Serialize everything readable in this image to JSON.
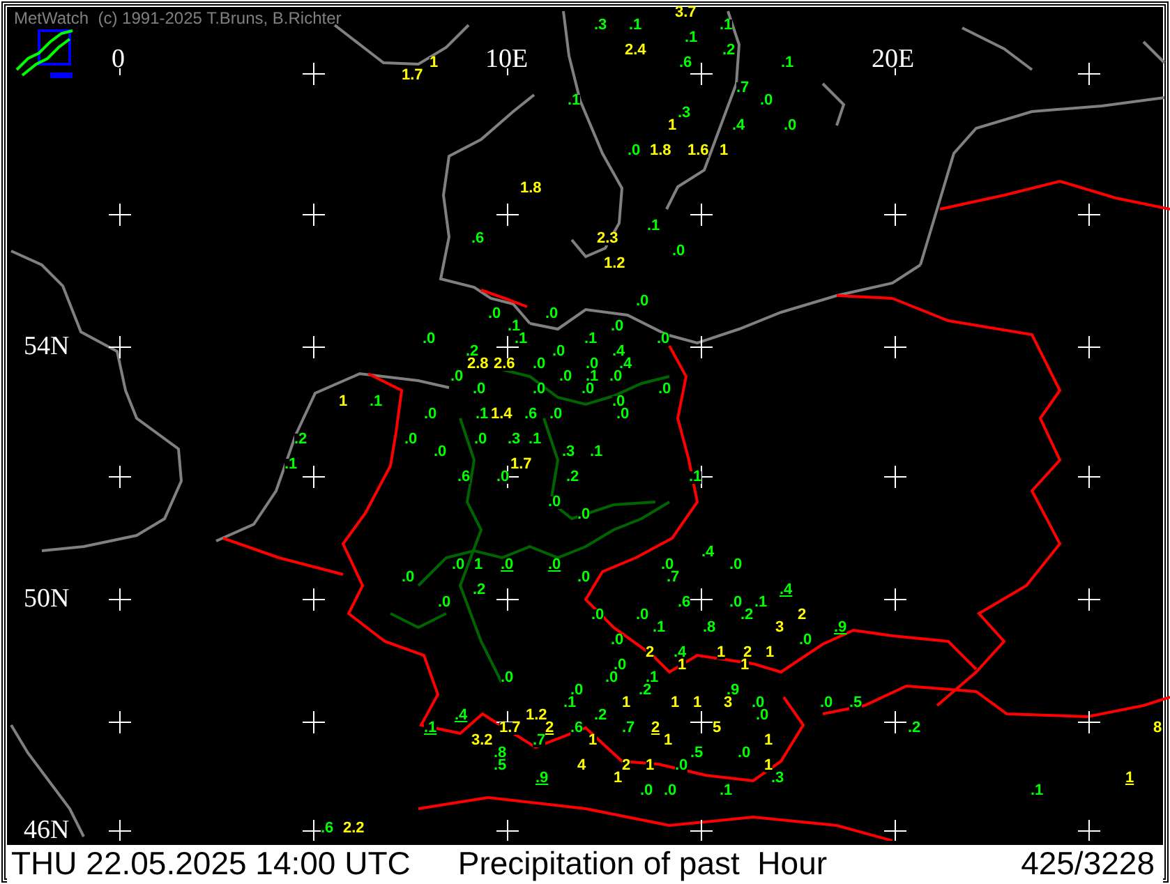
{
  "header": {
    "credit": "MetWatch  (c) 1991-2025 T.Bruns, B.Richter"
  },
  "grid_labels": [
    {
      "text": "0"
    },
    {
      "text": "10E"
    },
    {
      "text": "20E"
    },
    {
      "text": "54N"
    },
    {
      "text": "50N"
    },
    {
      "text": "46N"
    }
  ],
  "readings": [
    {
      "value": "3.7",
      "color": "#ffff00",
      "underlined": false
    },
    {
      "value": ".3",
      "color": "#00ff00",
      "underlined": false
    },
    {
      "value": ".1",
      "color": "#00ff00",
      "underlined": false
    },
    {
      "value": ".1",
      "color": "#00ff00",
      "underlined": false
    },
    {
      "value": ".1",
      "color": "#00ff00",
      "underlined": false
    },
    {
      "value": "2.4",
      "color": "#ffff00",
      "underlined": false
    },
    {
      "value": ".2",
      "color": "#00ff00",
      "underlined": false
    },
    {
      "value": "1",
      "color": "#ffff00",
      "underlined": false
    },
    {
      "value": ".6",
      "color": "#00ff00",
      "underlined": false
    },
    {
      "value": ".1",
      "color": "#00ff00",
      "underlined": false
    },
    {
      "value": "1.7",
      "color": "#ffff00",
      "underlined": false
    },
    {
      "value": ".7",
      "color": "#00ff00",
      "underlined": false
    },
    {
      "value": ".1",
      "color": "#00ff00",
      "underlined": false
    },
    {
      "value": ".0",
      "color": "#00ff00",
      "underlined": false
    },
    {
      "value": ".3",
      "color": "#00ff00",
      "underlined": false
    },
    {
      "value": "1",
      "color": "#ffff00",
      "underlined": false
    },
    {
      "value": ".4",
      "color": "#00ff00",
      "underlined": false
    },
    {
      "value": ".0",
      "color": "#00ff00",
      "underlined": false
    },
    {
      "value": ".0",
      "color": "#00ff00",
      "underlined": false
    },
    {
      "value": "1.8",
      "color": "#ffff00",
      "underlined": false
    },
    {
      "value": "1.6",
      "color": "#ffff00",
      "underlined": false
    },
    {
      "value": "1",
      "color": "#ffff00",
      "underlined": false
    },
    {
      "value": "1.8",
      "color": "#ffff00",
      "underlined": false
    },
    {
      "value": ".1",
      "color": "#00ff00",
      "underlined": false
    },
    {
      "value": ".6",
      "color": "#00ff00",
      "underlined": false
    },
    {
      "value": "2.3",
      "color": "#ffff00",
      "underlined": false
    },
    {
      "value": ".0",
      "color": "#00ff00",
      "underlined": false
    },
    {
      "value": "1.2",
      "color": "#ffff00",
      "underlined": false
    },
    {
      "value": ".0",
      "color": "#00ff00",
      "underlined": false
    },
    {
      "value": ".0",
      "color": "#00ff00",
      "underlined": false
    },
    {
      "value": ".0",
      "color": "#00ff00",
      "underlined": false
    },
    {
      "value": ".1",
      "color": "#00ff00",
      "underlined": false
    },
    {
      "value": ".0",
      "color": "#00ff00",
      "underlined": false
    },
    {
      "value": ".0",
      "color": "#00ff00",
      "underlined": false
    },
    {
      "value": ".1",
      "color": "#00ff00",
      "underlined": false
    },
    {
      "value": ".1",
      "color": "#00ff00",
      "underlined": false
    },
    {
      "value": ".0",
      "color": "#00ff00",
      "underlined": false
    },
    {
      "value": ".2",
      "color": "#00ff00",
      "underlined": false
    },
    {
      "value": ".0",
      "color": "#00ff00",
      "underlined": false
    },
    {
      "value": ".4",
      "color": "#00ff00",
      "underlined": false
    },
    {
      "value": "2.8",
      "color": "#ffff00",
      "underlined": false
    },
    {
      "value": "2.6",
      "color": "#ffff00",
      "underlined": false
    },
    {
      "value": ".0",
      "color": "#00ff00",
      "underlined": false
    },
    {
      "value": ".0",
      "color": "#00ff00",
      "underlined": false
    },
    {
      "value": ".4",
      "color": "#00ff00",
      "underlined": false
    },
    {
      "value": ".0",
      "color": "#00ff00",
      "underlined": false
    },
    {
      "value": ".0",
      "color": "#00ff00",
      "underlined": false
    },
    {
      "value": ".1",
      "color": "#00ff00",
      "underlined": false
    },
    {
      "value": ".0",
      "color": "#00ff00",
      "underlined": false
    },
    {
      "value": ".0",
      "color": "#00ff00",
      "underlined": false
    },
    {
      "value": ".0",
      "color": "#00ff00",
      "underlined": false
    },
    {
      "value": ".0",
      "color": "#00ff00",
      "underlined": false
    },
    {
      "value": ".0",
      "color": "#00ff00",
      "underlined": false
    },
    {
      "value": "1",
      "color": "#ffff00",
      "underlined": false
    },
    {
      "value": ".1",
      "color": "#00ff00",
      "underlined": false
    },
    {
      "value": ".0",
      "color": "#00ff00",
      "underlined": false
    },
    {
      "value": ".0",
      "color": "#00ff00",
      "underlined": false
    },
    {
      "value": ".1",
      "color": "#00ff00",
      "underlined": false
    },
    {
      "value": "1.4",
      "color": "#ffff00",
      "underlined": false
    },
    {
      "value": ".6",
      "color": "#00ff00",
      "underlined": false
    },
    {
      "value": ".0",
      "color": "#00ff00",
      "underlined": false
    },
    {
      "value": ".0",
      "color": "#00ff00",
      "underlined": false
    },
    {
      "value": ".2",
      "color": "#00ff00",
      "underlined": false
    },
    {
      "value": ".0",
      "color": "#00ff00",
      "underlined": false
    },
    {
      "value": ".0",
      "color": "#00ff00",
      "underlined": false
    },
    {
      "value": ".3",
      "color": "#00ff00",
      "underlined": false
    },
    {
      "value": ".1",
      "color": "#00ff00",
      "underlined": false
    },
    {
      "value": ".0",
      "color": "#00ff00",
      "underlined": false
    },
    {
      "value": ".3",
      "color": "#00ff00",
      "underlined": false
    },
    {
      "value": ".1",
      "color": "#00ff00",
      "underlined": false
    },
    {
      "value": ".1",
      "color": "#00ff00",
      "underlined": false
    },
    {
      "value": "1.7",
      "color": "#ffff00",
      "underlined": false
    },
    {
      "value": ".6",
      "color": "#00ff00",
      "underlined": false
    },
    {
      "value": ".0",
      "color": "#00ff00",
      "underlined": false
    },
    {
      "value": ".2",
      "color": "#00ff00",
      "underlined": false
    },
    {
      "value": ".1",
      "color": "#00ff00",
      "underlined": false
    },
    {
      "value": ".0",
      "color": "#00ff00",
      "underlined": false
    },
    {
      "value": ".0",
      "color": "#00ff00",
      "underlined": false
    },
    {
      "value": ".4",
      "color": "#00ff00",
      "underlined": false
    },
    {
      "value": ".0",
      "color": "#00ff00",
      "underlined": false
    },
    {
      "value": "1",
      "color": "#00ff00",
      "underlined": false
    },
    {
      "value": ".0",
      "color": "#00ff00",
      "underlined": true
    },
    {
      "value": ".0",
      "color": "#00ff00",
      "underlined": true
    },
    {
      "value": ".0",
      "color": "#00ff00",
      "underlined": false
    },
    {
      "value": ".0",
      "color": "#00ff00",
      "underlined": false
    },
    {
      "value": ".0",
      "color": "#00ff00",
      "underlined": false
    },
    {
      "value": ".0",
      "color": "#00ff00",
      "underlined": false
    },
    {
      "value": ".7",
      "color": "#00ff00",
      "underlined": false
    },
    {
      "value": ".2",
      "color": "#00ff00",
      "underlined": false
    },
    {
      "value": ".4",
      "color": "#00ff00",
      "underlined": true
    },
    {
      "value": ".0",
      "color": "#00ff00",
      "underlined": false
    },
    {
      "value": ".6",
      "color": "#00ff00",
      "underlined": false
    },
    {
      "value": ".0",
      "color": "#00ff00",
      "underlined": false
    },
    {
      "value": ".1",
      "color": "#00ff00",
      "underlined": false
    },
    {
      "value": ".0",
      "color": "#00ff00",
      "underlined": false
    },
    {
      "value": ".0",
      "color": "#00ff00",
      "underlined": false
    },
    {
      "value": ".2",
      "color": "#00ff00",
      "underlined": false
    },
    {
      "value": "2",
      "color": "#ffff00",
      "underlined": false
    },
    {
      "value": ".1",
      "color": "#00ff00",
      "underlined": false
    },
    {
      "value": ".8",
      "color": "#00ff00",
      "underlined": false
    },
    {
      "value": "3",
      "color": "#ffff00",
      "underlined": false
    },
    {
      "value": ".9",
      "color": "#00ff00",
      "underlined": true
    },
    {
      "value": ".0",
      "color": "#00ff00",
      "underlined": false
    },
    {
      "value": ".0",
      "color": "#00ff00",
      "underlined": false
    },
    {
      "value": "2",
      "color": "#ffff00",
      "underlined": false
    },
    {
      "value": ".4",
      "color": "#00ff00",
      "underlined": false
    },
    {
      "value": "1",
      "color": "#ffff00",
      "underlined": false
    },
    {
      "value": "2",
      "color": "#ffff00",
      "underlined": false
    },
    {
      "value": "1",
      "color": "#ffff00",
      "underlined": false
    },
    {
      "value": ".0",
      "color": "#00ff00",
      "underlined": false
    },
    {
      "value": "1",
      "color": "#ffff00",
      "underlined": false
    },
    {
      "value": "1",
      "color": "#ffff00",
      "underlined": false
    },
    {
      "value": ".0",
      "color": "#00ff00",
      "underlined": false
    },
    {
      "value": ".0",
      "color": "#00ff00",
      "underlined": false
    },
    {
      "value": ".1",
      "color": "#00ff00",
      "underlined": false
    },
    {
      "value": ".0",
      "color": "#00ff00",
      "underlined": false
    },
    {
      "value": ".2",
      "color": "#00ff00",
      "underlined": false
    },
    {
      "value": ".9",
      "color": "#00ff00",
      "underlined": false
    },
    {
      "value": ".1",
      "color": "#00ff00",
      "underlined": false
    },
    {
      "value": "1",
      "color": "#ffff00",
      "underlined": false
    },
    {
      "value": "1",
      "color": "#ffff00",
      "underlined": false
    },
    {
      "value": "1",
      "color": "#ffff00",
      "underlined": false
    },
    {
      "value": "3",
      "color": "#ffff00",
      "underlined": false
    },
    {
      "value": ".0",
      "color": "#00ff00",
      "underlined": false
    },
    {
      "value": ".0",
      "color": "#00ff00",
      "underlined": false
    },
    {
      "value": ".5",
      "color": "#00ff00",
      "underlined": false
    },
    {
      "value": ".4",
      "color": "#00ff00",
      "underlined": true
    },
    {
      "value": "1.2",
      "color": "#ffff00",
      "underlined": false
    },
    {
      "value": ".2",
      "color": "#00ff00",
      "underlined": false
    },
    {
      "value": ".0",
      "color": "#00ff00",
      "underlined": false
    },
    {
      "value": ".1",
      "color": "#00ff00",
      "underlined": true
    },
    {
      "value": "1.7",
      "color": "#ffff00",
      "underlined": false
    },
    {
      "value": "2",
      "color": "#ffff00",
      "underlined": true
    },
    {
      "value": ".6",
      "color": "#00ff00",
      "underlined": false
    },
    {
      "value": ".7",
      "color": "#00ff00",
      "underlined": false
    },
    {
      "value": "2",
      "color": "#ffff00",
      "underlined": true
    },
    {
      "value": "5",
      "color": "#ffff00",
      "underlined": false
    },
    {
      "value": ".2",
      "color": "#00ff00",
      "underlined": false
    },
    {
      "value": "8",
      "color": "#ffff00",
      "underlined": false
    },
    {
      "value": "3.2",
      "color": "#ffff00",
      "underlined": false
    },
    {
      "value": ".7",
      "color": "#00ff00",
      "underlined": false
    },
    {
      "value": "1",
      "color": "#ffff00",
      "underlined": false
    },
    {
      "value": "1",
      "color": "#ffff00",
      "underlined": false
    },
    {
      "value": "1",
      "color": "#ffff00",
      "underlined": false
    },
    {
      "value": ".8",
      "color": "#00ff00",
      "underlined": false
    },
    {
      "value": ".5",
      "color": "#00ff00",
      "underlined": false
    },
    {
      "value": ".0",
      "color": "#00ff00",
      "underlined": false
    },
    {
      "value": ".5",
      "color": "#00ff00",
      "underlined": false
    },
    {
      "value": "4",
      "color": "#ffff00",
      "underlined": false
    },
    {
      "value": "2",
      "color": "#ffff00",
      "underlined": false
    },
    {
      "value": "1",
      "color": "#ffff00",
      "underlined": false
    },
    {
      "value": ".0",
      "color": "#00ff00",
      "underlined": false
    },
    {
      "value": "1",
      "color": "#ffff00",
      "underlined": false
    },
    {
      "value": ".9",
      "color": "#00ff00",
      "underlined": true
    },
    {
      "value": "1",
      "color": "#ffff00",
      "underlined": false
    },
    {
      "value": ".3",
      "color": "#00ff00",
      "underlined": false
    },
    {
      "value": "1",
      "color": "#ffff00",
      "underlined": true
    },
    {
      "value": ".0",
      "color": "#00ff00",
      "underlined": false
    },
    {
      "value": ".0",
      "color": "#00ff00",
      "underlined": false
    },
    {
      "value": ".1",
      "color": "#00ff00",
      "underlined": false
    },
    {
      "value": ".1",
      "color": "#00ff00",
      "underlined": false
    },
    {
      "value": ".6",
      "color": "#00ff00",
      "underlined": false
    },
    {
      "value": "2.2",
      "color": "#ffff00",
      "underlined": false
    }
  ],
  "status_bar": {
    "datetime": "THU 22.05.2025 14:00 UTC",
    "title": "Precipitation of past  Hour",
    "count": "425/3228"
  }
}
